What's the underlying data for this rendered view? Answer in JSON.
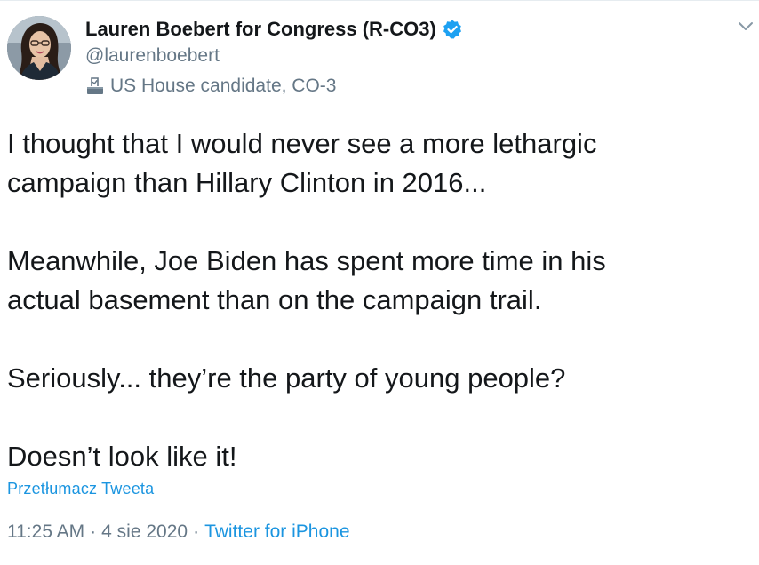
{
  "author": {
    "display_name": "Lauren Boebert for Congress (R-CO3)",
    "handle": "@laurenboebert",
    "label": "US House candidate, CO-3",
    "verified_icon": "verified-badge-icon",
    "label_icon": "ballot-box-icon"
  },
  "tweet": {
    "paragraphs": [
      "I thought that I would never see a more lethargic\ncampaign than Hillary Clinton in 2016...",
      "Meanwhile, Joe Biden has spent more time in his\nactual basement than on the campaign trail.",
      "Seriously... they’re the party of young people?",
      "Doesn’t look like it!"
    ],
    "translate_link": "Przetłumacz Tweeta",
    "time": "11:25 AM",
    "date": "4 sie 2020",
    "separator": "·",
    "source": "Twitter for iPhone"
  },
  "colors": {
    "link": "#1b95e0",
    "muted": "#657786",
    "text": "#14171a",
    "verified": "#1da1f2"
  }
}
